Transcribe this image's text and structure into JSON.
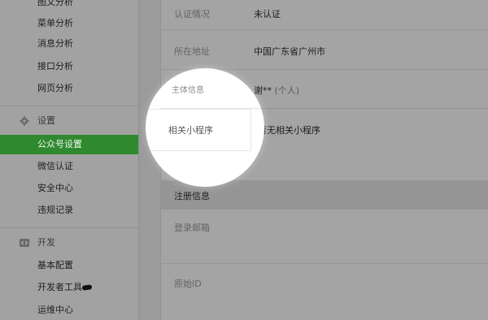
{
  "sidebar": {
    "items_top": [
      {
        "label": "图文分析"
      },
      {
        "label": "菜单分析"
      },
      {
        "label": "消息分析"
      },
      {
        "label": "接口分析"
      },
      {
        "label": "网页分析"
      }
    ],
    "settings_section": {
      "label": "设置",
      "icon": "gear-icon"
    },
    "settings_items": [
      {
        "label": "公众号设置",
        "active": true
      },
      {
        "label": "微信认证"
      },
      {
        "label": "安全中心"
      },
      {
        "label": "违规记录"
      }
    ],
    "dev_section": {
      "label": "开发",
      "icon": "code-icon"
    },
    "dev_items": [
      {
        "label": "基本配置"
      },
      {
        "label": "开发者工具"
      },
      {
        "label": "运维中心"
      }
    ],
    "active_color": "#2f8a2f"
  },
  "account_info": {
    "rows": [
      {
        "label": "认证情况",
        "value": "未认证"
      },
      {
        "label": "所在地址",
        "value": "中国广东省广州市"
      },
      {
        "label": "主体信息",
        "value": "谢**",
        "value_note": "(个人)"
      },
      {
        "label": "相关小程序",
        "value": "暂无相关小程序"
      }
    ]
  },
  "registration": {
    "section_title": "注册信息",
    "rows": [
      {
        "label": "登录邮箱",
        "value": ""
      },
      {
        "label": "原始ID",
        "value": ""
      }
    ]
  }
}
